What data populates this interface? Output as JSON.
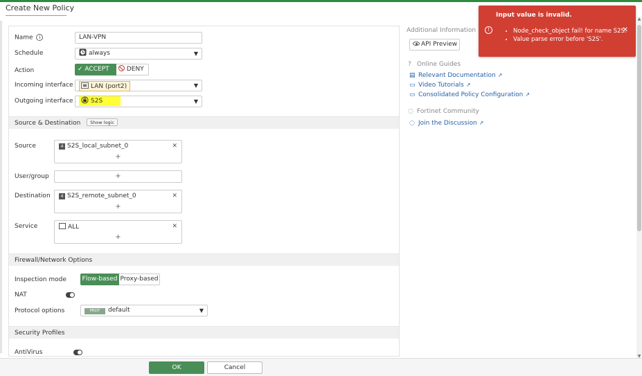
{
  "page": {
    "title": "Create New Policy"
  },
  "form": {
    "name": {
      "label": "Name",
      "value": "LAN-VPN"
    },
    "schedule": {
      "label": "Schedule",
      "value": "always"
    },
    "action": {
      "label": "Action",
      "accept": "ACCEPT",
      "deny": "DENY",
      "selected": "ACCEPT"
    },
    "incoming": {
      "label": "Incoming interface",
      "value": "LAN (port2)"
    },
    "outgoing": {
      "label": "Outgoing interface",
      "value": "S2S"
    },
    "source_dest": {
      "title": "Source & Destination",
      "show_logic": "Show logic",
      "source": {
        "label": "Source",
        "entry": "S2S_local_subnet_0"
      },
      "user_group": {
        "label": "User/group"
      },
      "destination": {
        "label": "Destination",
        "entry": "S2S_remote_subnet_0"
      },
      "service": {
        "label": "Service",
        "entry": "ALL"
      }
    },
    "firewall": {
      "title": "Firewall/Network Options",
      "inspection": {
        "label": "Inspection mode",
        "flow": "Flow-based",
        "proxy": "Proxy-based",
        "selected": "Flow-based"
      },
      "nat": {
        "label": "NAT"
      },
      "protocol": {
        "label": "Protocol options",
        "badge": "PROT",
        "value": "default"
      }
    },
    "security": {
      "title": "Security Profiles",
      "antivirus": {
        "label": "AntiVirus"
      }
    }
  },
  "sidebar": {
    "additional_info": "Additional Information",
    "api_preview": "API Preview",
    "online_guides": "Online Guides",
    "links": [
      "Relevant Documentation",
      "Video Tutorials",
      "Consolidated Policy Configuration"
    ],
    "community": "Fortinet Community",
    "discussion": "Join the Discussion"
  },
  "toast": {
    "title": "Input value is invalid.",
    "messages": [
      "Node_check_object fail! for name S2S.",
      "Value parse error before 'S2S'."
    ]
  },
  "footer": {
    "ok": "OK",
    "cancel": "Cancel"
  },
  "colors": {
    "accent_green": "#4a8e57",
    "error_red": "#d13f33",
    "link_blue": "#2560a8",
    "highlight_yellow": "#ffff33"
  }
}
